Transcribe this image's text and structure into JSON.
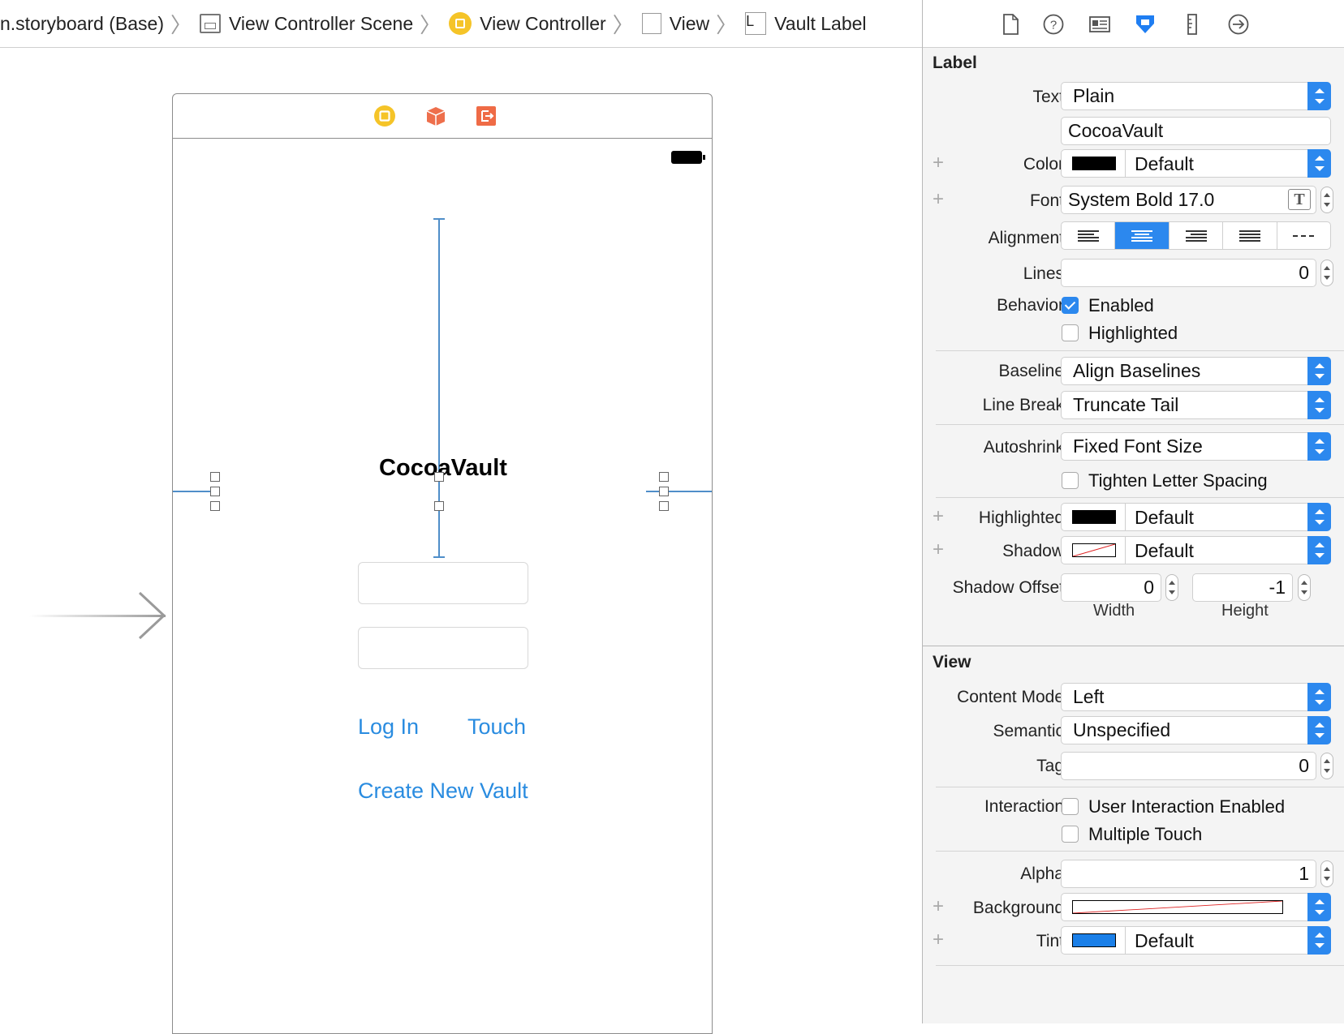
{
  "breadcrumb": {
    "items": [
      {
        "label": "n.storyboard (Base)",
        "icon": "none"
      },
      {
        "label": "View Controller Scene",
        "icon": "scene-icon"
      },
      {
        "label": "View Controller",
        "icon": "view-controller-icon"
      },
      {
        "label": "View",
        "icon": "view-icon"
      },
      {
        "label": "Vault Label",
        "icon": "label-icon"
      }
    ],
    "label_icon_text": "L"
  },
  "canvas": {
    "title_label": "CocoaVault",
    "login_link": "Log In",
    "touch_link": "Touch",
    "create_link": "Create New Vault",
    "link_color": "#2a8ce0",
    "constraint_color": "#4f8ec9"
  },
  "inspector": {
    "tabs": [
      "file-inspector-icon",
      "quick-help-icon",
      "identity-inspector-icon",
      "attributes-inspector-icon",
      "size-inspector-icon",
      "connections-inspector-icon"
    ],
    "active_tab": "attributes-inspector-icon",
    "label_section": {
      "title": "Label",
      "text_label": "Text",
      "text_value": "Plain",
      "text_content": "CocoaVault",
      "color_label": "Color",
      "color_value": "Default",
      "font_label": "Font",
      "font_value": "System Bold 17.0",
      "font_icon_text": "T",
      "alignment_label": "Alignment",
      "alignment_selected": "center",
      "lines_label": "Lines",
      "lines_value": "0",
      "behavior_label": "Behavior",
      "enabled_label": "Enabled",
      "enabled_checked": true,
      "highlighted_cb_label": "Highlighted",
      "highlighted_checked": false,
      "baseline_label": "Baseline",
      "baseline_value": "Align Baselines",
      "linebreak_label": "Line Break",
      "linebreak_value": "Truncate Tail",
      "autoshrink_label": "Autoshrink",
      "autoshrink_value": "Fixed Font Size",
      "tighten_label": "Tighten Letter Spacing",
      "tighten_checked": false,
      "highlighted_label": "Highlighted",
      "highlighted_value": "Default",
      "shadow_label": "Shadow",
      "shadow_value": "Default",
      "shadow_offset_label": "Shadow Offset",
      "shadow_width": "0",
      "shadow_height": "-1",
      "width_label": "Width",
      "height_label": "Height"
    },
    "view_section": {
      "title": "View",
      "content_mode_label": "Content Mode",
      "content_mode_value": "Left",
      "semantic_label": "Semantic",
      "semantic_value": "Unspecified",
      "tag_label": "Tag",
      "tag_value": "0",
      "interaction_label": "Interaction",
      "user_interaction_label": "User Interaction Enabled",
      "user_interaction_checked": false,
      "multiple_touch_label": "Multiple Touch",
      "multiple_touch_checked": false,
      "alpha_label": "Alpha",
      "alpha_value": "1",
      "background_label": "Background",
      "tint_label": "Tint",
      "tint_value": "Default",
      "tint_color": "#1a7fe8"
    },
    "plus_symbol": "+"
  }
}
